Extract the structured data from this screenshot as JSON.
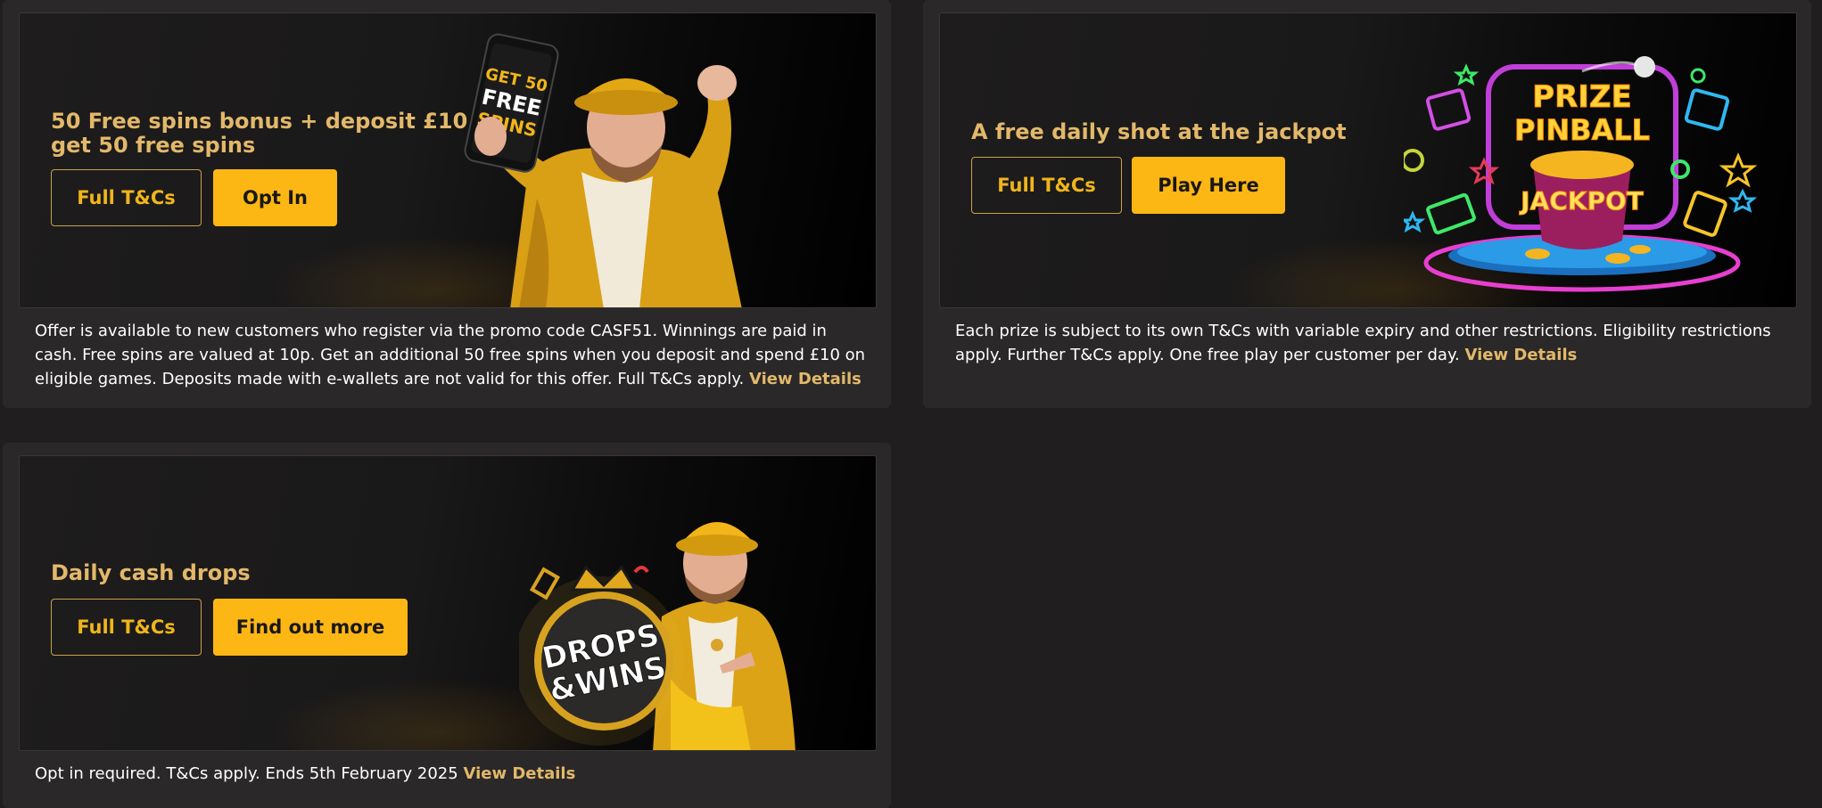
{
  "promos": [
    {
      "title": "50 Free spins bonus + deposit £10 get 50 free spins",
      "tcs_label": "Full T&Cs",
      "action_label": "Opt In",
      "phone_text_1": "GET 50",
      "phone_text_2": "FREE",
      "phone_text_3": "SPINS",
      "description": "Offer is available to new customers who register via the promo code CASF51. Winnings are paid in cash. Free spins are valued at 10p. Get an additional 50 free spins when you deposit and spend £10 on eligible games. Deposits made with e-wallets are not valid for this offer. Full T&Cs apply.",
      "link_label": "View Details"
    },
    {
      "title": "A free daily shot at the jackpot",
      "tcs_label": "Full T&Cs",
      "action_label": "Play Here",
      "art_line_1": "PRIZE",
      "art_line_2": "PINBALL",
      "art_line_3": "JACKPOT",
      "description": "Each prize is subject to its own T&Cs with variable expiry and other restrictions. Eligibility restrictions apply. Further T&Cs apply. One free play per customer per day.",
      "link_label": "View Details"
    },
    {
      "title": "Daily cash drops",
      "tcs_label": "Full T&Cs",
      "action_label": "Find out more",
      "art_line_1": "DROPS",
      "art_line_2": "&WINS",
      "description": "Opt in required. T&Cs apply. Ends 5th February 2025",
      "link_label": "View Details"
    }
  ],
  "colors": {
    "page_bg": "#201e1e",
    "card_bg": "#2a2828",
    "accent": "#fdb714",
    "title_gold": "#e2b86a"
  }
}
